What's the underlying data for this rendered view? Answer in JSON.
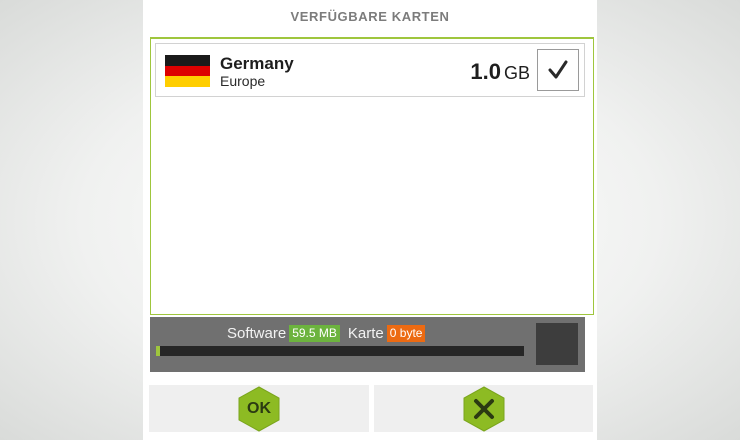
{
  "header": {
    "title": "VERFÜGBARE KARTEN"
  },
  "maps": [
    {
      "country": "Germany",
      "region": "Europe",
      "size_value": "1.0",
      "size_unit": "GB",
      "selected": true,
      "flag_colors": [
        "#1a1a1a",
        "#dd0000",
        "#ffce00"
      ]
    }
  ],
  "status": {
    "software_label": "Software",
    "software_size": "59.5 MB",
    "map_label": "Karte",
    "map_size": "0 byte",
    "progress_fraction": 0.01
  },
  "buttons": {
    "ok_label": "OK"
  },
  "colors": {
    "accent_green": "#9fc63d",
    "software_badge": "#6cb33e",
    "map_badge": "#ec6a12"
  }
}
